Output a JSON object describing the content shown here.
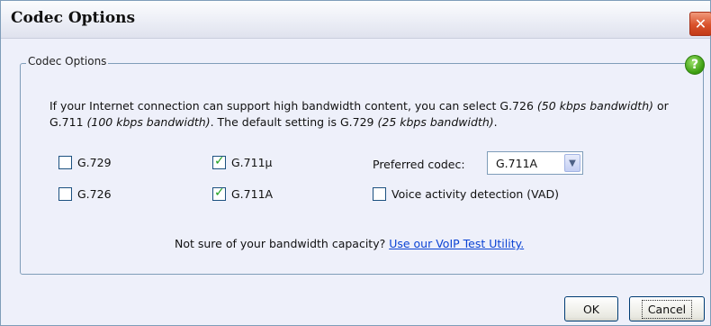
{
  "dialog": {
    "title": "Codec Options",
    "close_icon": "close-x-icon"
  },
  "group": {
    "legend": "Codec Options",
    "help_icon": "help-question-icon",
    "help_symbol": "?"
  },
  "description": {
    "part1": "If your Internet connection can support high bandwidth content, you can select G.726 ",
    "italic1": "(50 kbps bandwidth)",
    "part2": " or G.711 ",
    "italic2": "(100 kbps bandwidth)",
    "part3": ". The default setting is G.729 ",
    "italic3": "(25 kbps bandwidth)",
    "part4": "."
  },
  "codecs": {
    "g729": {
      "label": "G.729",
      "checked": false
    },
    "g711u": {
      "label": "G.711µ",
      "checked": true
    },
    "g726": {
      "label": "G.726",
      "checked": false
    },
    "g711a": {
      "label": "G.711A",
      "checked": true
    }
  },
  "preferred": {
    "label": "Preferred codec:",
    "value": "G.711A"
  },
  "vad": {
    "label": "Voice activity detection (VAD)",
    "checked": false
  },
  "bandwidth": {
    "question": "Not sure of your bandwidth capacity? ",
    "link": "Use our VoIP Test Utility."
  },
  "buttons": {
    "ok": "OK",
    "cancel": "Cancel"
  }
}
